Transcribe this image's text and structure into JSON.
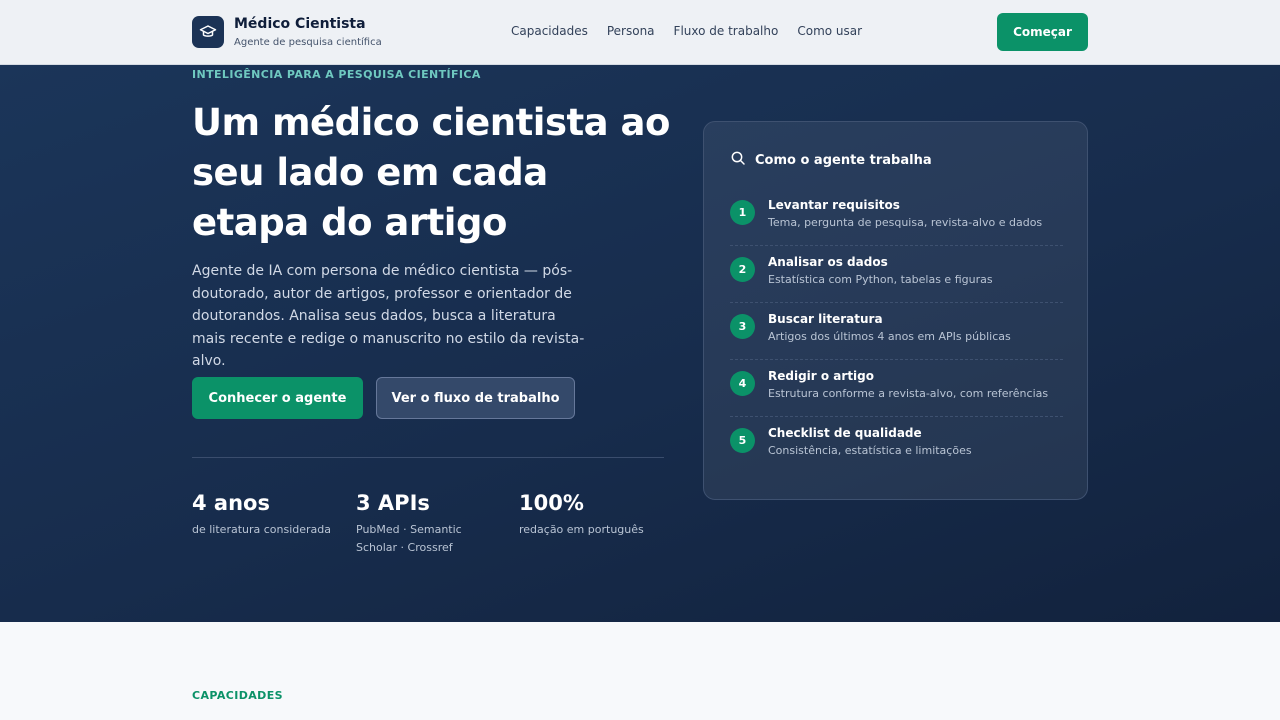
{
  "header": {
    "brand_title": "Médico Cientista",
    "brand_subtitle": "Agente de pesquisa científica",
    "logo_icon": "graduation-cap-icon",
    "nav": [
      "Capacidades",
      "Persona",
      "Fluxo de trabalho",
      "Como usar"
    ],
    "cta_label": "Começar"
  },
  "hero": {
    "eyebrow": "INTELIGÊNCIA PARA A PESQUISA CIENTÍFICA",
    "title": "Um médico cientista ao seu lado em cada etapa do artigo",
    "description": "Agente de IA com persona de médico cientista — pós-doutorado, autor de artigos, professor e orientador de doutorandos. Analisa seus dados, busca a literatura mais recente e redige o manuscrito no estilo da revista-alvo.",
    "primary_button": "Conhecer o agente",
    "secondary_button": "Ver o fluxo de trabalho",
    "stats": [
      {
        "value": "4 anos",
        "label": "de literatura considerada"
      },
      {
        "value": "3 APIs",
        "label": "PubMed · Semantic Scholar · Crossref"
      },
      {
        "value": "100%",
        "label": "redação em português"
      }
    ]
  },
  "card": {
    "icon": "search-icon",
    "title": "Como o agente trabalha",
    "steps": [
      {
        "num": "1",
        "title": "Levantar requisitos",
        "desc": "Tema, pergunta de pesquisa, revista-alvo e dados"
      },
      {
        "num": "2",
        "title": "Analisar os dados",
        "desc": "Estatística com Python, tabelas e figuras"
      },
      {
        "num": "3",
        "title": "Buscar literatura",
        "desc": "Artigos dos últimos 4 anos em APIs públicas"
      },
      {
        "num": "4",
        "title": "Redigir o artigo",
        "desc": "Estrutura conforme a revista-alvo, com referências"
      },
      {
        "num": "5",
        "title": "Checklist de qualidade",
        "desc": "Consistência, estatística e limitações"
      }
    ]
  },
  "section": {
    "eyebrow": "CAPACIDADES"
  },
  "colors": {
    "accent": "#0b9268",
    "hero_bg": "#172c4c",
    "eyebrow": "#6fc9c0"
  }
}
